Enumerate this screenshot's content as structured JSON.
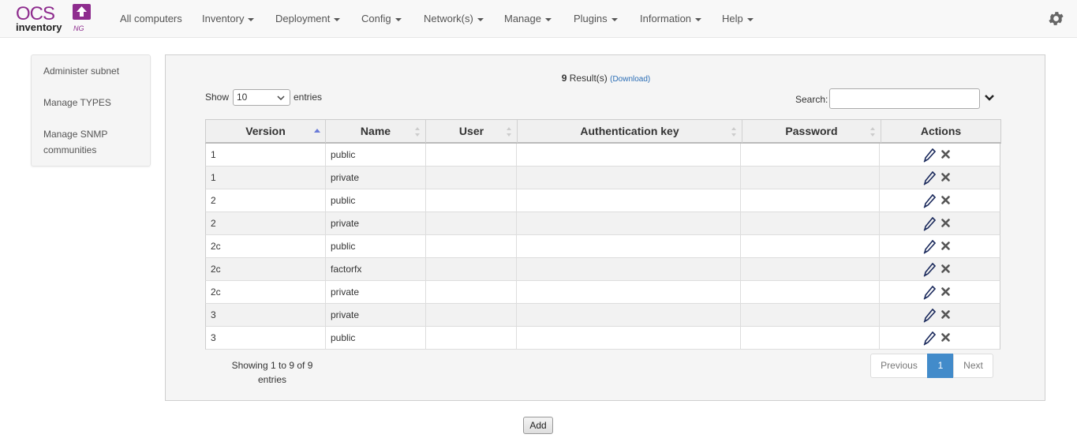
{
  "nav": {
    "items": [
      {
        "label": "All computers",
        "dropdown": false
      },
      {
        "label": "Inventory",
        "dropdown": true
      },
      {
        "label": "Deployment",
        "dropdown": true
      },
      {
        "label": "Config",
        "dropdown": true
      },
      {
        "label": "Network(s)",
        "dropdown": true
      },
      {
        "label": "Manage",
        "dropdown": true
      },
      {
        "label": "Plugins",
        "dropdown": true
      },
      {
        "label": "Information",
        "dropdown": true
      },
      {
        "label": "Help",
        "dropdown": true
      }
    ],
    "logo_text_top": "OCS",
    "logo_text_bottom": "inventory",
    "logo_text_ng": "NG",
    "logo_color": "#8e2c8e"
  },
  "sidebar": {
    "items": [
      {
        "label": "Administer subnet"
      },
      {
        "label": "Manage TYPES"
      },
      {
        "label": "Manage SNMP communities"
      }
    ]
  },
  "results": {
    "count": "9",
    "suffix": "Result(s)",
    "download": "(Download)"
  },
  "length": {
    "show": "Show",
    "value": "10",
    "entries": "entries"
  },
  "search": {
    "label": "Search:",
    "value": ""
  },
  "table": {
    "columns": [
      "Version",
      "Name",
      "User",
      "Authentication key",
      "Password",
      "Actions"
    ],
    "rows": [
      {
        "version": "1",
        "name": "public",
        "user": "",
        "auth": "",
        "password": ""
      },
      {
        "version": "1",
        "name": "private",
        "user": "",
        "auth": "",
        "password": ""
      },
      {
        "version": "2",
        "name": "public",
        "user": "",
        "auth": "",
        "password": ""
      },
      {
        "version": "2",
        "name": "private",
        "user": "",
        "auth": "",
        "password": ""
      },
      {
        "version": "2c",
        "name": "public",
        "user": "",
        "auth": "",
        "password": ""
      },
      {
        "version": "2c",
        "name": "factorfx",
        "user": "",
        "auth": "",
        "password": ""
      },
      {
        "version": "2c",
        "name": "private",
        "user": "",
        "auth": "",
        "password": ""
      },
      {
        "version": "3",
        "name": "private",
        "user": "",
        "auth": "",
        "password": ""
      },
      {
        "version": "3",
        "name": "public",
        "user": "",
        "auth": "",
        "password": ""
      }
    ],
    "sorted_column": "Version",
    "sort_direction": "ascending"
  },
  "info": {
    "text": "Showing 1 to 9 of 9 entries"
  },
  "pagination": {
    "previous": "Previous",
    "current": "1",
    "next": "Next"
  },
  "add_button": "Add",
  "colors": {
    "accent": "#428bca",
    "link": "#2a6db5",
    "brand": "#8e2c8e"
  }
}
